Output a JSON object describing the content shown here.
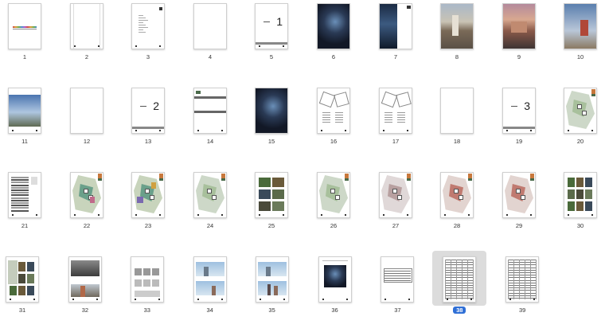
{
  "pages": [
    {
      "n": "1",
      "style": "cover"
    },
    {
      "n": "2",
      "style": "blank-lines"
    },
    {
      "n": "3",
      "style": "text"
    },
    {
      "n": "4",
      "style": "blank"
    },
    {
      "n": "5",
      "style": "part",
      "label": "1"
    },
    {
      "n": "6",
      "style": "photo-dark"
    },
    {
      "n": "7",
      "style": "photo-half"
    },
    {
      "n": "8",
      "style": "photo-city"
    },
    {
      "n": "9",
      "style": "photo-dusk"
    },
    {
      "n": "10",
      "style": "photo-sky"
    },
    {
      "n": "11",
      "style": "photo-sky2"
    },
    {
      "n": "12",
      "style": "blank"
    },
    {
      "n": "13",
      "style": "part",
      "label": "2"
    },
    {
      "n": "14",
      "style": "text-bars"
    },
    {
      "n": "15",
      "style": "photo-dark"
    },
    {
      "n": "16",
      "style": "plan-gray"
    },
    {
      "n": "17",
      "style": "plan-line"
    },
    {
      "n": "18",
      "style": "blank"
    },
    {
      "n": "19",
      "style": "part",
      "label": "3"
    },
    {
      "n": "20",
      "style": "site-green"
    },
    {
      "n": "21",
      "style": "table"
    },
    {
      "n": "22",
      "style": "site-color"
    },
    {
      "n": "23",
      "style": "site-color2"
    },
    {
      "n": "24",
      "style": "site-plan"
    },
    {
      "n": "25",
      "style": "photo-grid"
    },
    {
      "n": "26",
      "style": "site-plan"
    },
    {
      "n": "27",
      "style": "site-pink"
    },
    {
      "n": "28",
      "style": "site-red"
    },
    {
      "n": "29",
      "style": "site-red"
    },
    {
      "n": "30",
      "style": "photo-grid2"
    },
    {
      "n": "31",
      "style": "photo-grid3"
    },
    {
      "n": "32",
      "style": "render"
    },
    {
      "n": "33",
      "style": "diagram"
    },
    {
      "n": "34",
      "style": "elevation"
    },
    {
      "n": "35",
      "style": "elevation2"
    },
    {
      "n": "36",
      "style": "photo-dark2"
    },
    {
      "n": "37",
      "style": "spec-table"
    },
    {
      "n": "38",
      "style": "big-table",
      "selected": true
    },
    {
      "n": "39",
      "style": "big-table"
    }
  ]
}
